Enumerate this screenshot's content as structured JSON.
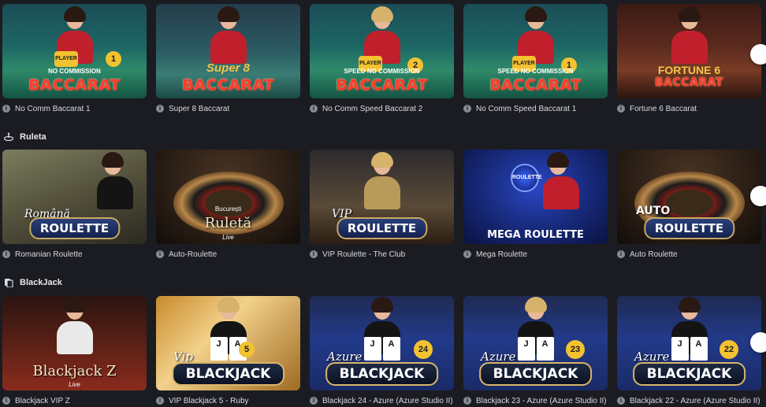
{
  "colors": {
    "background": "#1b1c22",
    "text": "#e8e8ea",
    "info": "#8a8c94",
    "accent_gold": "#c9a862",
    "baccarat_red": "#ff3c2e"
  },
  "row_baccarat": {
    "items": [
      {
        "title": "No Comm Baccarat 1",
        "logo": "BACCARAT",
        "sub": "NO COMMISSION",
        "badge": "1",
        "label": "PLAYER"
      },
      {
        "title": "Super 8 Baccarat",
        "logo": "BACCARAT",
        "sub": "Super 8"
      },
      {
        "title": "No Comm Speed Baccarat 2",
        "logo": "BACCARAT",
        "sub": "SPEED  NO COMMISSION",
        "badge": "2",
        "label": "PLAYER"
      },
      {
        "title": "No Comm Speed Baccarat 1",
        "logo": "BACCARAT",
        "sub": "SPEED  NO COMMISSION",
        "badge": "1",
        "label": "PLAYER"
      },
      {
        "title": "Fortune 6 Baccarat",
        "logo": "BACCARAT",
        "sub": "FORTUNE 6"
      }
    ]
  },
  "section_roulette": {
    "title": "Ruleta",
    "icon": "roulette-icon"
  },
  "row_roulette": {
    "items": [
      {
        "title": "Romanian Roulette",
        "logo": "ROULETTE",
        "script": "Română"
      },
      {
        "title": "Auto-Roulette",
        "logo": "Ruletă",
        "small": "București",
        "live": "Live"
      },
      {
        "title": "VIP Roulette - The Club",
        "logo": "ROULETTE",
        "script": "VIP"
      },
      {
        "title": "Mega Roulette",
        "logo": "MEGA ROULETTE",
        "badge": "ROULETTE"
      },
      {
        "title": "Auto Roulette",
        "logo": "ROULETTE",
        "word": "AUTO"
      }
    ]
  },
  "section_blackjack": {
    "title": "BlackJack",
    "icon": "cards-icon"
  },
  "row_blackjack": {
    "items": [
      {
        "title": "Blackjack VIP Z",
        "logo": "Blackjack Z",
        "live": "Live"
      },
      {
        "title": "VIP Blackjack 5 - Ruby",
        "logo": "BLACKJACK",
        "script": "Vip",
        "badge": "5"
      },
      {
        "title": "Blackjack 24 - Azure (Azure Studio II)",
        "logo": "BLACKJACK",
        "script": "Azure",
        "badge": "24"
      },
      {
        "title": "Blackjack 23 - Azure (Azure Studio II)",
        "logo": "BLACKJACK",
        "script": "Azure",
        "badge": "23"
      },
      {
        "title": "Blackjack 22 - Azure (Azure Studio II)",
        "logo": "BLACKJACK",
        "script": "Azure",
        "badge": "22"
      }
    ]
  },
  "info_glyph": "i",
  "card_glyphs": [
    "J",
    "A"
  ]
}
